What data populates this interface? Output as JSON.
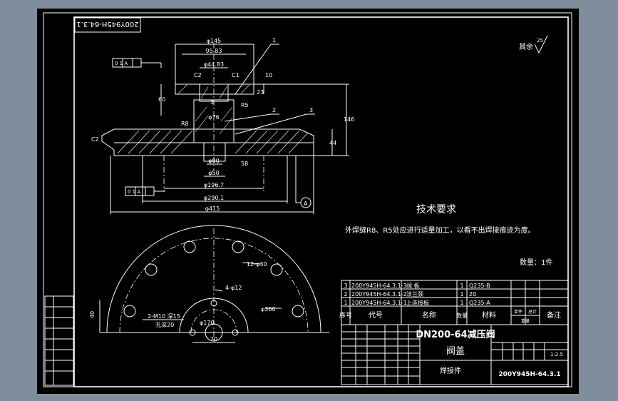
{
  "drawing_number_top": "200Y945H-64.3.1",
  "tech_requirements": {
    "title": "技术要求",
    "text": "外焊缝R8、R5处应进行适量加工，以看不出焊接痕迹为度。"
  },
  "quantity": "数量：1件",
  "roughness_note": "其余",
  "roughness_value": "25",
  "dims": {
    "d145": "φ145",
    "d95": "95.83",
    "d44": "φ44.83",
    "c2a": "C2",
    "c1": "C1",
    "d10": "10",
    "d60": "60",
    "d23": "23",
    "r5": "R5",
    "b1": "1",
    "b2": "2",
    "b3": "3",
    "d3": "3",
    "d76": "φ76",
    "r8": "R8",
    "c2b": "C2",
    "d146": "146",
    "d44b": "44",
    "d90": "φ90",
    "d50": "φ50",
    "d196": "φ196.7",
    "d290": "φ290.1",
    "d415": "φ415",
    "a": "A",
    "fifty8": "58",
    "d12x30": "12-φ30",
    "d4x12": "4-φ12",
    "d360": "φ360",
    "m10": "2-M10 深15",
    "kong": "孔深20",
    "d170": "φ170",
    "d70": "70",
    "d40": "40",
    "tol1": "0 1 A",
    "tol2": "0 1 A"
  },
  "parts_table": {
    "rows": [
      {
        "no": "3",
        "code": "200Y945H-64.3.1-3",
        "name": "阀 板",
        "qty": "1",
        "mat": "Q235-B"
      },
      {
        "no": "2",
        "code": "200Y945H-64.3.1-2",
        "name": "法兰颈",
        "qty": "1",
        "mat": "20"
      },
      {
        "no": "1",
        "code": "200Y945H-64.3.1-1",
        "name": "上连接板",
        "qty": "1",
        "mat": "Q235-A"
      }
    ],
    "headers": {
      "no": "序号",
      "code": "代号",
      "name": "名称",
      "qty": "数量",
      "mat": "材料",
      "single": "单件",
      "total": "总计",
      "weight": "重量",
      "note": "备注"
    }
  },
  "title_block": {
    "product": "DN200-64减压阀",
    "part": "阀盖",
    "type": "焊接件",
    "scale": "1:2.5",
    "drawing_no": "200Y945H-64.3.1"
  }
}
